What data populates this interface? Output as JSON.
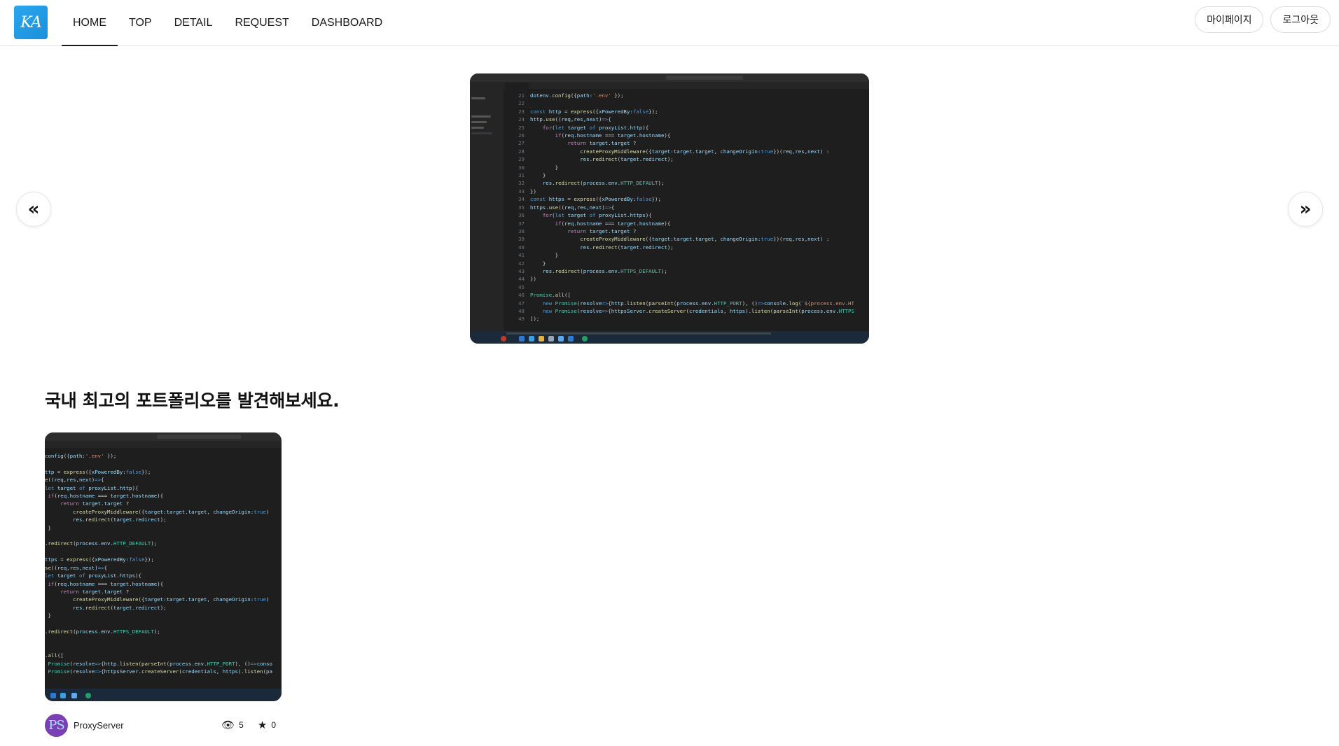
{
  "brand": {
    "logo_text": "KA",
    "color": "#1a8fd9"
  },
  "nav": {
    "items": [
      {
        "label": "HOME",
        "active": true
      },
      {
        "label": "TOP",
        "active": false
      },
      {
        "label": "DETAIL",
        "active": false
      },
      {
        "label": "REQUEST",
        "active": false
      },
      {
        "label": "DASHBOARD",
        "active": false
      }
    ],
    "mypage_label": "마이페이지",
    "logout_label": "로그아웃"
  },
  "carousel": {
    "prev_icon": "double-chevron-left-icon",
    "next_icon": "double-chevron-right-icon",
    "prev_glyph": "«",
    "next_glyph": "»"
  },
  "section": {
    "title": "국내 최고의 포트폴리오를 발견해보세요."
  },
  "cards": [
    {
      "author": "ProxyServer",
      "avatar_text": "PS",
      "views": "5",
      "stars": "0"
    }
  ]
}
